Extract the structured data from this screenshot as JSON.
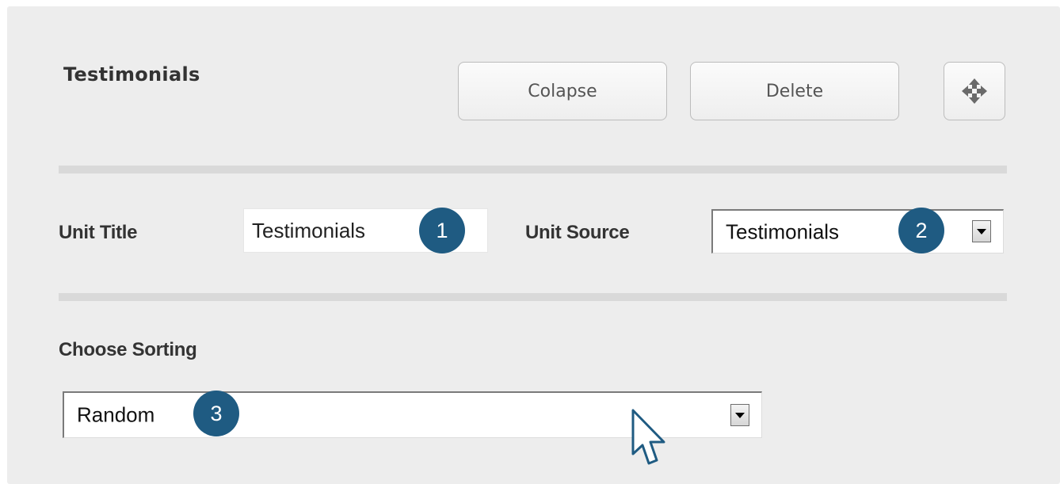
{
  "header": {
    "title": "Testimonials",
    "collapse_label": "Colapse",
    "delete_label": "Delete"
  },
  "unit_title": {
    "label": "Unit Title",
    "value": "Testimonials"
  },
  "unit_source": {
    "label": "Unit Source",
    "selected": "Testimonials"
  },
  "sorting": {
    "label": "Choose Sorting",
    "selected": "Random"
  },
  "callouts": [
    "1",
    "2",
    "3"
  ],
  "icons": {
    "move": "move-arrows-icon",
    "dropdown": "dropdown-arrow-icon",
    "cursor": "mouse-pointer-icon"
  },
  "colors": {
    "panel_background": "#ededed",
    "divider": "#d9d9d9",
    "callout_badge": "#1f5b82",
    "cursor_outline": "#1f5b82"
  }
}
